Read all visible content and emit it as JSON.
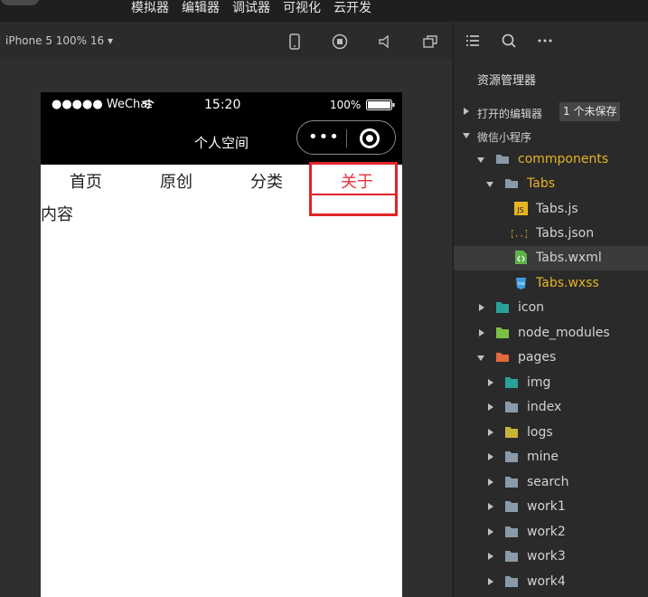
{
  "menubar": {
    "items": [
      "模拟器",
      "编辑器",
      "调试器",
      "可视化",
      "云开发"
    ]
  },
  "simulator": {
    "device": "iPhone 5 100% 16 ▾"
  },
  "phone": {
    "status": {
      "signal": "●●●●● WeChat",
      "time": "15:20",
      "battery": "100%"
    },
    "nav_title": "个人空间",
    "capsule_dots": "•••",
    "tabs": [
      "首页",
      "原创",
      "分类",
      "关于"
    ],
    "active_tab": "关于",
    "content": "内容"
  },
  "explorer": {
    "title": "资源管理器",
    "open_editors": "打开的编辑器",
    "unsaved_badge": "1 个未保存",
    "project": "微信小程序",
    "tree": [
      {
        "label": "commponents",
        "color": "#e6b422"
      },
      {
        "label": "Tabs",
        "color": "#e6b422"
      },
      {
        "label": "Tabs.js"
      },
      {
        "label": "Tabs.json"
      },
      {
        "label": "Tabs.wxml"
      },
      {
        "label": "Tabs.wxss",
        "color": "#e6b422"
      },
      {
        "label": "icon"
      },
      {
        "label": "node_modules"
      },
      {
        "label": "pages"
      },
      {
        "label": "img"
      },
      {
        "label": "index"
      },
      {
        "label": "logs"
      },
      {
        "label": "mine"
      },
      {
        "label": "search"
      },
      {
        "label": "work1"
      },
      {
        "label": "work2"
      },
      {
        "label": "work3"
      },
      {
        "label": "work4"
      }
    ],
    "icons": {
      "js": "JS",
      "json": "{..}",
      "wxss": "css"
    }
  }
}
